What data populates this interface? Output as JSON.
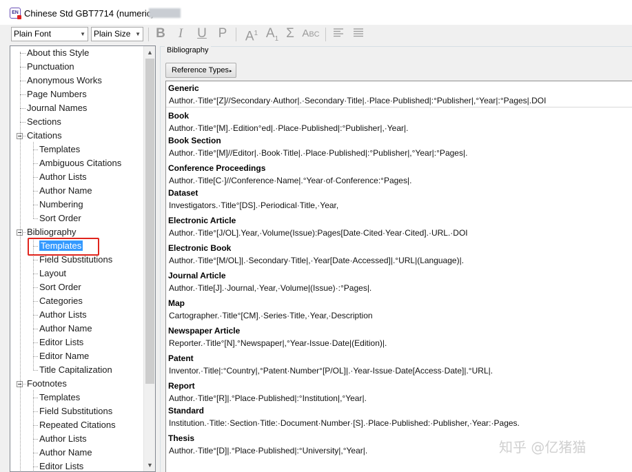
{
  "window": {
    "title": "Chinese Std GBT7714 (numeric)",
    "app_icon_text": "EN"
  },
  "toolbar": {
    "font_select": "Plain Font",
    "size_select": "Plain Size",
    "bold": "B",
    "italic": "I",
    "underline": "U",
    "plain": "P",
    "superscript": "A",
    "superscript_mark": "1",
    "subscript": "A",
    "subscript_mark": "1",
    "symbol": "Σ",
    "smallcaps": "Abc"
  },
  "tree": {
    "items": [
      {
        "label": "About this Style",
        "level": 0
      },
      {
        "label": "Punctuation",
        "level": 0
      },
      {
        "label": "Anonymous Works",
        "level": 0
      },
      {
        "label": "Page Numbers",
        "level": 0
      },
      {
        "label": "Journal Names",
        "level": 0
      },
      {
        "label": "Sections",
        "level": 0
      },
      {
        "label": "Citations",
        "level": 0,
        "expanded": true
      },
      {
        "label": "Templates",
        "level": 1
      },
      {
        "label": "Ambiguous Citations",
        "level": 1
      },
      {
        "label": "Author Lists",
        "level": 1
      },
      {
        "label": "Author Name",
        "level": 1
      },
      {
        "label": "Numbering",
        "level": 1
      },
      {
        "label": "Sort Order",
        "level": 1
      },
      {
        "label": "Bibliography",
        "level": 0,
        "expanded": true
      },
      {
        "label": "Templates",
        "level": 1,
        "selected": true
      },
      {
        "label": "Field Substitutions",
        "level": 1
      },
      {
        "label": "Layout",
        "level": 1
      },
      {
        "label": "Sort Order",
        "level": 1
      },
      {
        "label": "Categories",
        "level": 1
      },
      {
        "label": "Author Lists",
        "level": 1
      },
      {
        "label": "Author Name",
        "level": 1
      },
      {
        "label": "Editor Lists",
        "level": 1
      },
      {
        "label": "Editor Name",
        "level": 1
      },
      {
        "label": "Title Capitalization",
        "level": 1
      },
      {
        "label": "Footnotes",
        "level": 0,
        "expanded": true
      },
      {
        "label": "Templates",
        "level": 1
      },
      {
        "label": "Field Substitutions",
        "level": 1
      },
      {
        "label": "Repeated Citations",
        "level": 1
      },
      {
        "label": "Author Lists",
        "level": 1
      },
      {
        "label": "Author Name",
        "level": 1
      },
      {
        "label": "Editor Lists",
        "level": 1
      }
    ]
  },
  "panel": {
    "group_label": "Bibliography",
    "ref_types_button": "Reference Types",
    "ref_types_arrow": "▸"
  },
  "templates": [
    {
      "title": "Generic",
      "template": "Author.·Title°[Z]//Secondary·Author|.·Secondary·Title|.·Place·Published|:°Publisher|,°Year|:°Pages|.DOI"
    },
    {
      "title": "Book",
      "template": "Author.·Title°[M].·Edition°ed|.·Place·Published|:°Publisher|,·Year|."
    },
    {
      "title": "Book Section",
      "template": "Author.·Title°[M]//Editor|.·Book·Title|.·Place·Published|:°Publisher|,°Year|:°Pages|."
    },
    {
      "title": "Conference Proceedings",
      "template": "Author.·Title[C·]//Conference·Name|.°Year·of·Conference:°Pages|."
    },
    {
      "title": "Dataset",
      "template": "Investigators.·Title°[DS].·Periodical·Title,·Year,"
    },
    {
      "title": "Electronic Article",
      "template": "Author.·Title°[J/OL].Year,·Volume(Issue):Pages[Date·Cited·Year·Cited].·URL.·DOI"
    },
    {
      "title": "Electronic Book",
      "template": "Author.·Title°[M/OL]|.·Secondary·Title|,·Year[Date·Accessed]|.°URL|(Language)|."
    },
    {
      "title": "Journal Article",
      "template": "Author.·Title[J].·Journal,·Year,·Volume|(Issue)·:°Pages|."
    },
    {
      "title": "Map",
      "template": "Cartographer.·Title°[CM].·Series·Title,·Year,·Description"
    },
    {
      "title": "Newspaper Article",
      "template": "Reporter.·Title°[N].°Newspaper|,°Year-Issue·Date|(Edition)|."
    },
    {
      "title": "Patent",
      "template": "Inventor.·Title|:°Country|,°Patent·Number°[P/OL]|.·Year-Issue·Date[Access·Date]|.°URL|."
    },
    {
      "title": "Report",
      "template": "Author.·Title°[R]|.°Place·Published|:°Institution|,°Year|."
    },
    {
      "title": "Standard",
      "template": "Institution.·Title:·Section·Title:·Document·Number·[S].·Place·Published:·Publisher,·Year:·Pages."
    },
    {
      "title": "Thesis",
      "template": "Author.·Title°[D]|.°Place·Published|:°University|,°Year|."
    }
  ],
  "watermark": "知乎 @亿猪猫",
  "colors": {
    "selection": "#3399ff",
    "highlight_box": "#e0241c",
    "disabled_icon": "#9a9a9a"
  }
}
